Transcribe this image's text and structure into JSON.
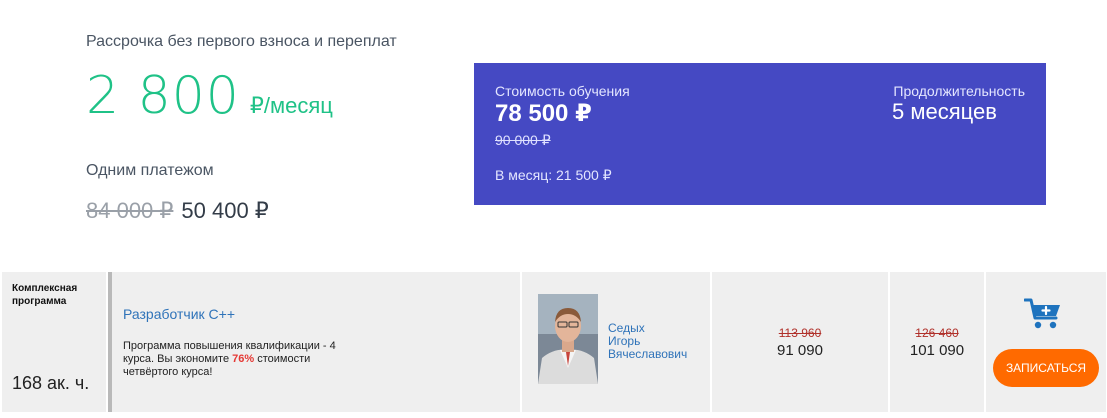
{
  "installment": {
    "title": "Рассрочка без первого взноса и переплат",
    "amount": "2 800",
    "unit": "₽/месяц"
  },
  "one_payment": {
    "title": "Одним платежом",
    "old_price": "84 000 ₽",
    "new_price": "50 400 ₽"
  },
  "panel": {
    "cost_label": "Стоимость обучения",
    "cost": "78 500 ₽",
    "cost_old": "90 000 ₽",
    "per_month": "В месяц: 21 500 ₽",
    "duration_label": "Продолжительность",
    "duration": "5 месяцев",
    "background_color": "#4549c3"
  },
  "course": {
    "tag": "Комплексная программа",
    "hours": "168 ак. ч.",
    "title": "Разработчик С++",
    "desc_before": "Программа повышения квалификации - 4 курса. Вы экономите ",
    "desc_percent": "76%",
    "desc_after": " стоимости четвёртого курса!",
    "teacher": [
      "Седых",
      "Игорь",
      "Вячеславович"
    ],
    "price1_old": "113 960",
    "price1_new": "91 090",
    "price2_old": "126 460",
    "price2_new": "101 090",
    "cart_icon": "add-to-cart-icon",
    "enroll_label": "ЗАПИСАТЬСЯ",
    "accent_color": "#ff6a00"
  }
}
